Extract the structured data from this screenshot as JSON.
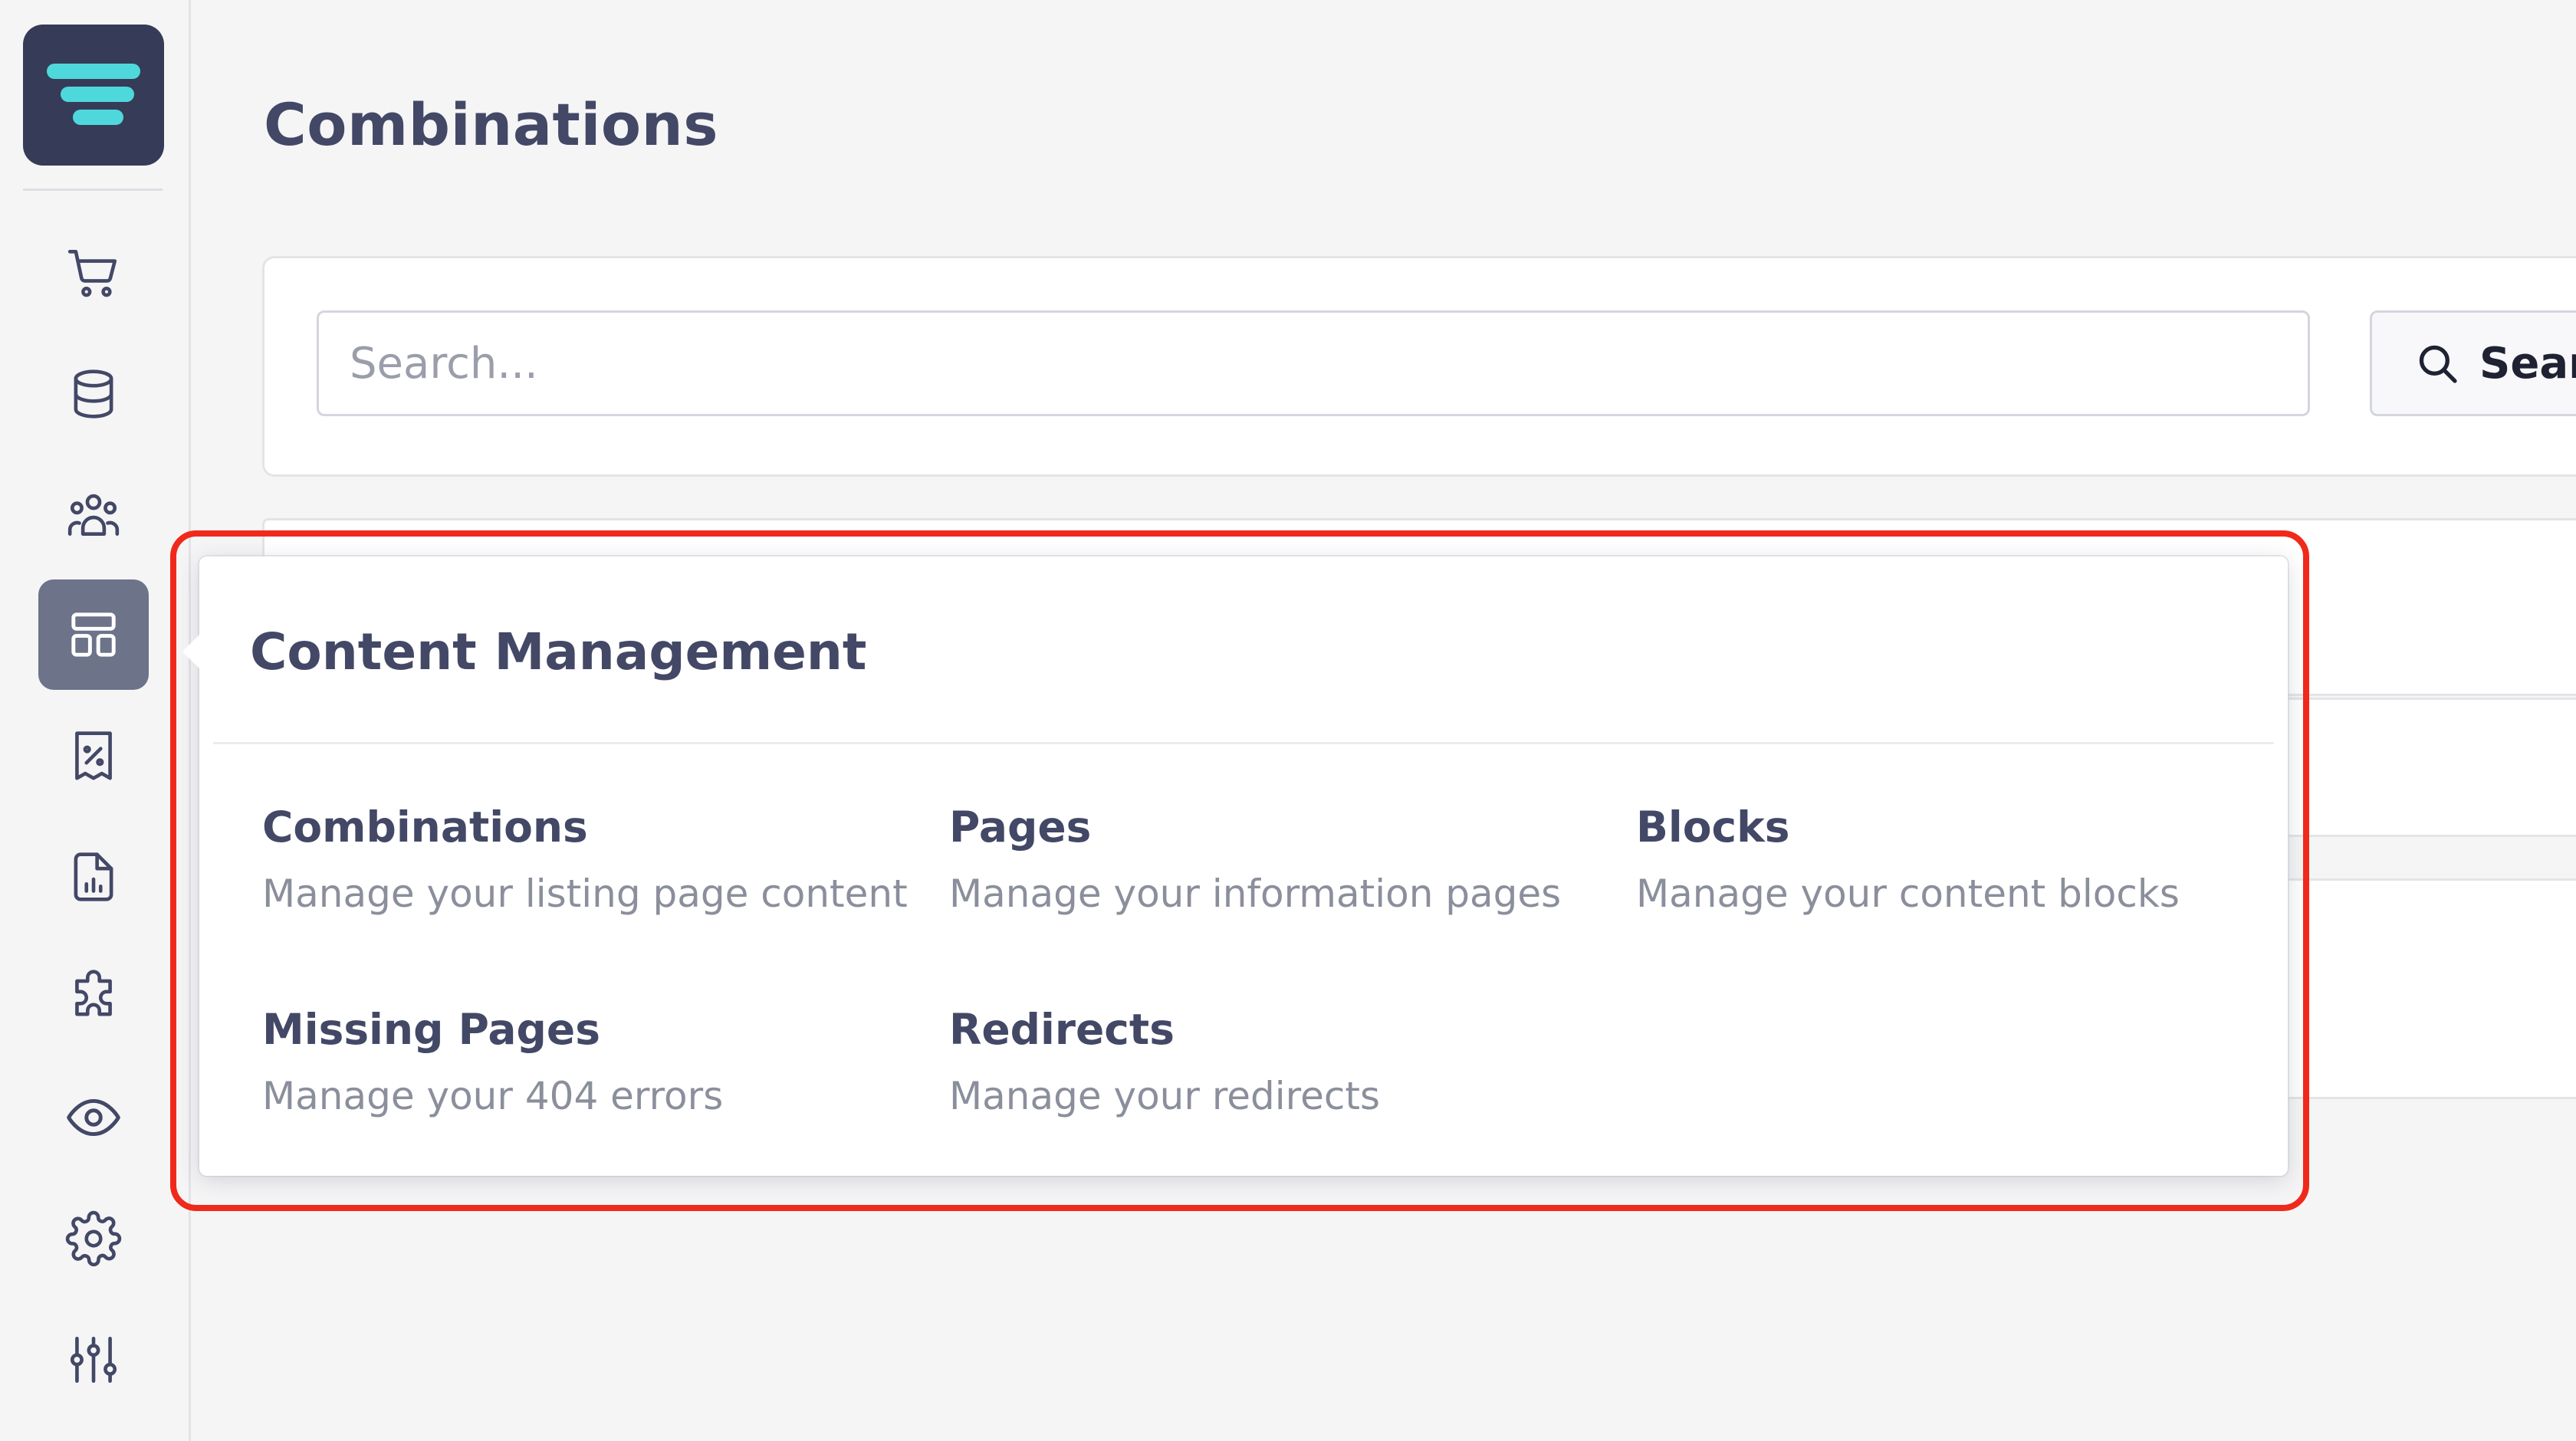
{
  "page": {
    "title": "Combinations"
  },
  "search": {
    "placeholder": "Search...",
    "button_label": "Search"
  },
  "sidebar": {
    "logo": "app-logo",
    "items": [
      {
        "name": "cart-icon"
      },
      {
        "name": "database-icon"
      },
      {
        "name": "users-group-icon"
      },
      {
        "name": "layout-icon",
        "active": true
      },
      {
        "name": "discount-receipt-icon"
      },
      {
        "name": "report-file-icon"
      },
      {
        "name": "puzzle-icon"
      },
      {
        "name": "eye-icon"
      },
      {
        "name": "gear-icon"
      },
      {
        "name": "sliders-icon"
      }
    ]
  },
  "popover": {
    "title": "Content Management",
    "entries": [
      {
        "title": "Combinations",
        "description": "Manage your listing page content"
      },
      {
        "title": "Pages",
        "description": "Manage your information pages"
      },
      {
        "title": "Blocks",
        "description": "Manage your content blocks"
      },
      {
        "title": "Missing Pages",
        "description": "Manage your 404 errors"
      },
      {
        "title": "Redirects",
        "description": "Manage your redirects"
      }
    ]
  },
  "colors": {
    "sidebar_active": "#6d7389",
    "logo_bg": "#363b58",
    "logo_accent": "#4fd8dc",
    "text_primary": "#434866",
    "text_secondary": "#8b8f9c",
    "highlight": "#f0291a"
  }
}
